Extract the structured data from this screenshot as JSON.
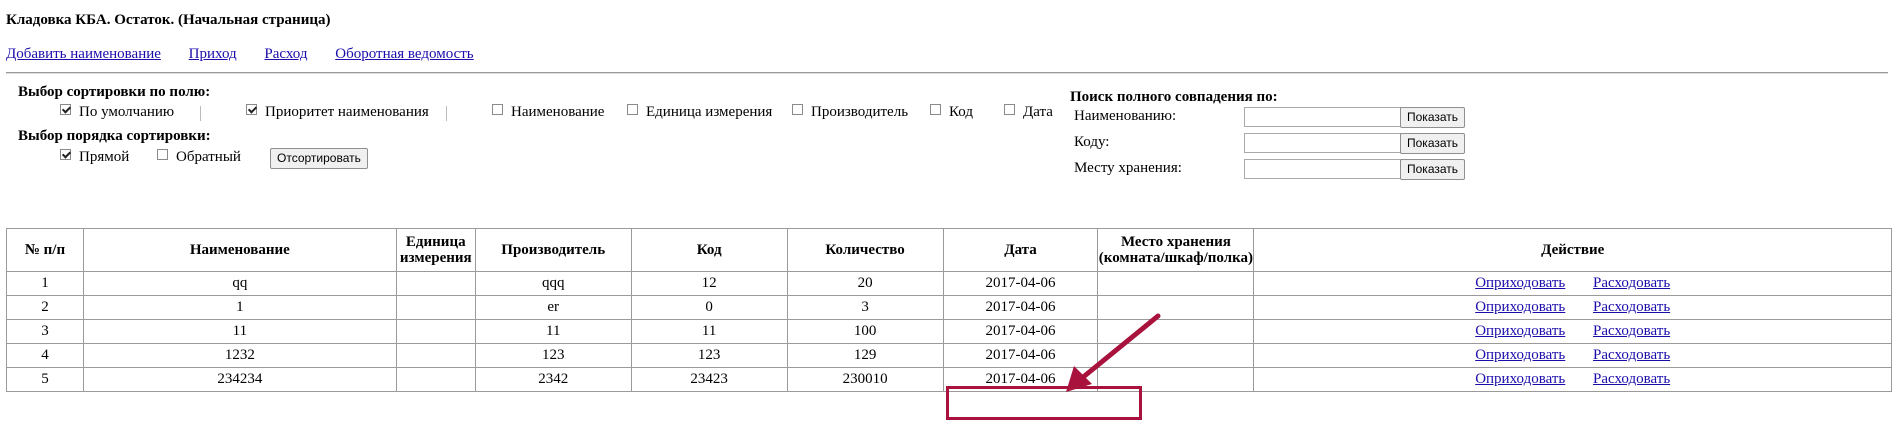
{
  "page": {
    "title": "Кладовка КБА. Остаток. (Начальная страница)"
  },
  "nav": [
    {
      "label": "Добавить наименование"
    },
    {
      "label": "Приход"
    },
    {
      "label": "Расход"
    },
    {
      "label": "Оборотная ведомость"
    }
  ],
  "sort": {
    "field_title": "Выбор сортировки по полю:",
    "fields": [
      {
        "label": "По умолчанию",
        "checked": true
      },
      {
        "label": "Приоритет наименования",
        "checked": true
      },
      {
        "label": "Наименование",
        "checked": false
      },
      {
        "label": "Единица измерения",
        "checked": false
      },
      {
        "label": "Производитель",
        "checked": false
      },
      {
        "label": "Код",
        "checked": false
      },
      {
        "label": "Дата",
        "checked": false
      }
    ],
    "order_title": "Выбор порядка сортировки:",
    "orders": [
      {
        "label": "Прямой",
        "checked": true
      },
      {
        "label": "Обратный",
        "checked": false
      }
    ],
    "sort_button": "Отсортировать"
  },
  "search": {
    "title": "Поиск полного совпадения по:",
    "rows": [
      {
        "label": "Наименованию:",
        "value": "",
        "button": "Показать"
      },
      {
        "label": "Коду:",
        "value": "",
        "button": "Показать"
      },
      {
        "label": "Месту хранения:",
        "value": "",
        "button": "Показать"
      }
    ]
  },
  "table": {
    "headers": [
      "№ п/п",
      "Наименование",
      "Единица измерения",
      "Производитель",
      "Код",
      "Количество",
      "Дата",
      "Место хранения (комната/шкаф/полка)",
      "Действие"
    ],
    "rows": [
      {
        "n": "1",
        "name": "qq",
        "unit": "",
        "maker": "qqq",
        "code": "12",
        "qty": "20",
        "date": "2017-04-06",
        "place": ""
      },
      {
        "n": "2",
        "name": "1",
        "unit": "",
        "maker": "er",
        "code": "0",
        "qty": "3",
        "date": "2017-04-06",
        "place": ""
      },
      {
        "n": "3",
        "name": "11",
        "unit": "",
        "maker": "11",
        "code": "11",
        "qty": "100",
        "date": "2017-04-06",
        "place": ""
      },
      {
        "n": "4",
        "name": "1232",
        "unit": "",
        "maker": "123",
        "code": "123",
        "qty": "129",
        "date": "2017-04-06",
        "place": ""
      },
      {
        "n": "5",
        "name": "234234",
        "unit": "",
        "maker": "2342",
        "code": "23423",
        "qty": "230010",
        "date": "2017-04-06",
        "place": ""
      }
    ],
    "action_income": "Оприходовать",
    "action_expense": "Расходовать"
  },
  "annotation": {
    "color": "#a8123c"
  }
}
